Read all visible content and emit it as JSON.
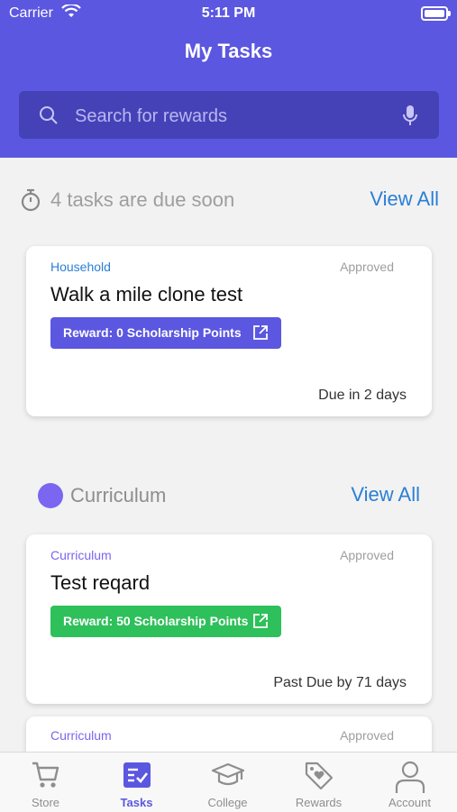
{
  "status_bar": {
    "carrier": "Carrier",
    "time": "5:11 PM"
  },
  "header": {
    "title": "My Tasks"
  },
  "search": {
    "placeholder": "Search for rewards"
  },
  "due_soon": {
    "text": "4 tasks are due soon",
    "view_all": "View All"
  },
  "due_cards": [
    {
      "category": "Household",
      "status": "Approved",
      "title": "Walk a mile clone test",
      "reward": "Reward: 0 Scholarship Points",
      "due": "Due in 2 days",
      "reward_color": "#5b57e0",
      "category_color": "#2a7fd6"
    }
  ],
  "curriculum": {
    "label": "Curriculum",
    "view_all": "View All"
  },
  "curriculum_cards": [
    {
      "category": "Curriculum",
      "status": "Approved",
      "title": "Test reqard",
      "reward": "Reward: 50 Scholarship Points",
      "due": "Past Due by 71 days",
      "reward_color": "#2ec05a",
      "category_color": "#7a66f0"
    },
    {
      "category": "Curriculum",
      "status": "Approved"
    }
  ],
  "tabs": [
    {
      "label": "Store",
      "icon": "cart-icon",
      "active": false
    },
    {
      "label": "Tasks",
      "icon": "tasks-icon",
      "active": true
    },
    {
      "label": "College",
      "icon": "graduation-cap-icon",
      "active": false
    },
    {
      "label": "Rewards",
      "icon": "tag-heart-icon",
      "active": false
    },
    {
      "label": "Account",
      "icon": "person-icon",
      "active": false
    }
  ],
  "colors": {
    "brand": "#5b57e0",
    "link": "#2a7fd6"
  }
}
